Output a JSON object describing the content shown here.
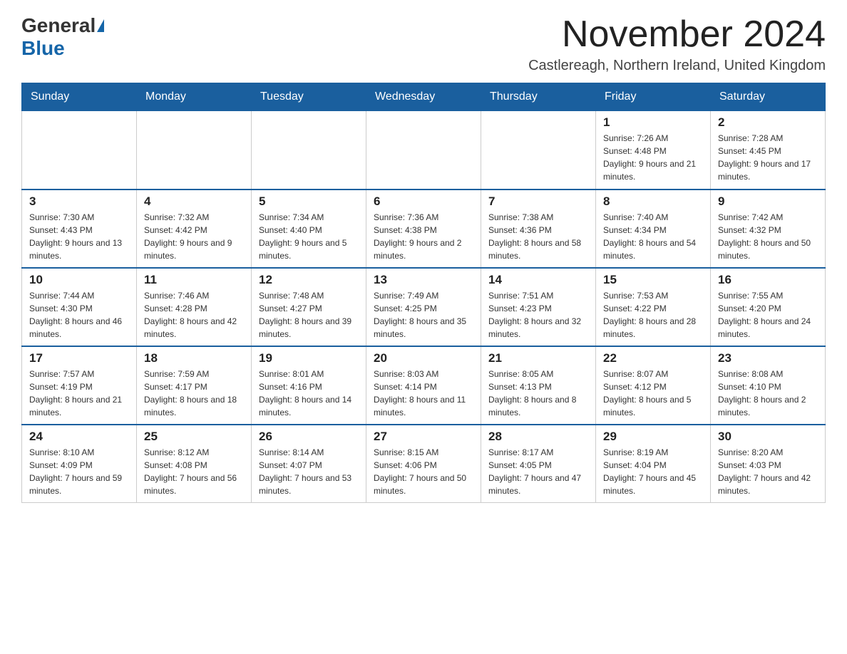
{
  "header": {
    "logo_general": "General",
    "logo_blue": "Blue",
    "month_title": "November 2024",
    "subtitle": "Castlereagh, Northern Ireland, United Kingdom"
  },
  "weekdays": [
    "Sunday",
    "Monday",
    "Tuesday",
    "Wednesday",
    "Thursday",
    "Friday",
    "Saturday"
  ],
  "rows": [
    {
      "cells": [
        {
          "day": "",
          "info": ""
        },
        {
          "day": "",
          "info": ""
        },
        {
          "day": "",
          "info": ""
        },
        {
          "day": "",
          "info": ""
        },
        {
          "day": "",
          "info": ""
        },
        {
          "day": "1",
          "info": "Sunrise: 7:26 AM\nSunset: 4:48 PM\nDaylight: 9 hours and 21 minutes."
        },
        {
          "day": "2",
          "info": "Sunrise: 7:28 AM\nSunset: 4:45 PM\nDaylight: 9 hours and 17 minutes."
        }
      ]
    },
    {
      "cells": [
        {
          "day": "3",
          "info": "Sunrise: 7:30 AM\nSunset: 4:43 PM\nDaylight: 9 hours and 13 minutes."
        },
        {
          "day": "4",
          "info": "Sunrise: 7:32 AM\nSunset: 4:42 PM\nDaylight: 9 hours and 9 minutes."
        },
        {
          "day": "5",
          "info": "Sunrise: 7:34 AM\nSunset: 4:40 PM\nDaylight: 9 hours and 5 minutes."
        },
        {
          "day": "6",
          "info": "Sunrise: 7:36 AM\nSunset: 4:38 PM\nDaylight: 9 hours and 2 minutes."
        },
        {
          "day": "7",
          "info": "Sunrise: 7:38 AM\nSunset: 4:36 PM\nDaylight: 8 hours and 58 minutes."
        },
        {
          "day": "8",
          "info": "Sunrise: 7:40 AM\nSunset: 4:34 PM\nDaylight: 8 hours and 54 minutes."
        },
        {
          "day": "9",
          "info": "Sunrise: 7:42 AM\nSunset: 4:32 PM\nDaylight: 8 hours and 50 minutes."
        }
      ]
    },
    {
      "cells": [
        {
          "day": "10",
          "info": "Sunrise: 7:44 AM\nSunset: 4:30 PM\nDaylight: 8 hours and 46 minutes."
        },
        {
          "day": "11",
          "info": "Sunrise: 7:46 AM\nSunset: 4:28 PM\nDaylight: 8 hours and 42 minutes."
        },
        {
          "day": "12",
          "info": "Sunrise: 7:48 AM\nSunset: 4:27 PM\nDaylight: 8 hours and 39 minutes."
        },
        {
          "day": "13",
          "info": "Sunrise: 7:49 AM\nSunset: 4:25 PM\nDaylight: 8 hours and 35 minutes."
        },
        {
          "day": "14",
          "info": "Sunrise: 7:51 AM\nSunset: 4:23 PM\nDaylight: 8 hours and 32 minutes."
        },
        {
          "day": "15",
          "info": "Sunrise: 7:53 AM\nSunset: 4:22 PM\nDaylight: 8 hours and 28 minutes."
        },
        {
          "day": "16",
          "info": "Sunrise: 7:55 AM\nSunset: 4:20 PM\nDaylight: 8 hours and 24 minutes."
        }
      ]
    },
    {
      "cells": [
        {
          "day": "17",
          "info": "Sunrise: 7:57 AM\nSunset: 4:19 PM\nDaylight: 8 hours and 21 minutes."
        },
        {
          "day": "18",
          "info": "Sunrise: 7:59 AM\nSunset: 4:17 PM\nDaylight: 8 hours and 18 minutes."
        },
        {
          "day": "19",
          "info": "Sunrise: 8:01 AM\nSunset: 4:16 PM\nDaylight: 8 hours and 14 minutes."
        },
        {
          "day": "20",
          "info": "Sunrise: 8:03 AM\nSunset: 4:14 PM\nDaylight: 8 hours and 11 minutes."
        },
        {
          "day": "21",
          "info": "Sunrise: 8:05 AM\nSunset: 4:13 PM\nDaylight: 8 hours and 8 minutes."
        },
        {
          "day": "22",
          "info": "Sunrise: 8:07 AM\nSunset: 4:12 PM\nDaylight: 8 hours and 5 minutes."
        },
        {
          "day": "23",
          "info": "Sunrise: 8:08 AM\nSunset: 4:10 PM\nDaylight: 8 hours and 2 minutes."
        }
      ]
    },
    {
      "cells": [
        {
          "day": "24",
          "info": "Sunrise: 8:10 AM\nSunset: 4:09 PM\nDaylight: 7 hours and 59 minutes."
        },
        {
          "day": "25",
          "info": "Sunrise: 8:12 AM\nSunset: 4:08 PM\nDaylight: 7 hours and 56 minutes."
        },
        {
          "day": "26",
          "info": "Sunrise: 8:14 AM\nSunset: 4:07 PM\nDaylight: 7 hours and 53 minutes."
        },
        {
          "day": "27",
          "info": "Sunrise: 8:15 AM\nSunset: 4:06 PM\nDaylight: 7 hours and 50 minutes."
        },
        {
          "day": "28",
          "info": "Sunrise: 8:17 AM\nSunset: 4:05 PM\nDaylight: 7 hours and 47 minutes."
        },
        {
          "day": "29",
          "info": "Sunrise: 8:19 AM\nSunset: 4:04 PM\nDaylight: 7 hours and 45 minutes."
        },
        {
          "day": "30",
          "info": "Sunrise: 8:20 AM\nSunset: 4:03 PM\nDaylight: 7 hours and 42 minutes."
        }
      ]
    }
  ]
}
